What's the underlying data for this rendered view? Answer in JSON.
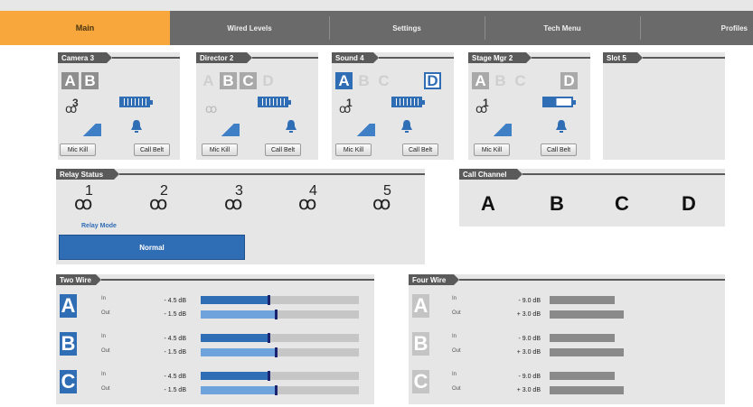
{
  "nav": {
    "tabs": [
      {
        "label": "Main",
        "active": true
      },
      {
        "label": "Wired Levels",
        "active": false
      },
      {
        "label": "Settings",
        "active": false
      },
      {
        "label": "Tech Menu",
        "active": false
      },
      {
        "label": "Profiles",
        "active": false
      }
    ]
  },
  "beltpacks": [
    {
      "name": "Camera 3",
      "channels": [
        "A",
        "B"
      ],
      "relay": "3",
      "battery_level": 1.0,
      "button1": "Mic Kill",
      "button2": "Call Belt"
    },
    {
      "name": "Director 2",
      "channels": [
        "A",
        "B",
        "C",
        "D"
      ],
      "relay": "",
      "battery_level": 1.0,
      "button1": "Mic Kill",
      "button2": "Call Belt"
    },
    {
      "name": "Sound 4",
      "channels": [
        "A",
        "B",
        "C",
        "D"
      ],
      "relay": "1",
      "battery_level": 1.0,
      "button1": "Mic Kill",
      "button2": "Call Belt"
    },
    {
      "name": "Stage Mgr 2",
      "channels": [
        "A",
        "B",
        "C",
        "D"
      ],
      "relay": "1",
      "battery_level": 0.45,
      "button1": "Mic Kill",
      "button2": "Call Belt"
    },
    {
      "name": "Slot 5"
    }
  ],
  "relay_status": {
    "title": "Relay Status",
    "relays": [
      "1",
      "2",
      "3",
      "4",
      "5"
    ],
    "mode_label": "Relay Mode",
    "mode_value": "Normal"
  },
  "call_channel": {
    "title": "Call Channel",
    "channels": [
      "A",
      "B",
      "C",
      "D"
    ]
  },
  "two_wire": {
    "title": "Two Wire",
    "in_label": "In",
    "out_label": "Out",
    "rows": [
      {
        "letter": "A",
        "in_db": "- 4.5 dB",
        "out_db": "- 1.5 dB",
        "in_level": 0.42,
        "out_level": 0.47
      },
      {
        "letter": "B",
        "in_db": "- 4.5 dB",
        "out_db": "- 1.5 dB",
        "in_level": 0.42,
        "out_level": 0.47
      },
      {
        "letter": "C",
        "in_db": "- 4.5 dB",
        "out_db": "- 1.5 dB",
        "in_level": 0.42,
        "out_level": 0.47
      }
    ]
  },
  "four_wire": {
    "title": "Four Wire",
    "in_label": "In",
    "out_label": "Out",
    "rows": [
      {
        "letter": "A",
        "in_db": "- 9.0 dB",
        "out_db": "+ 3.0 dB"
      },
      {
        "letter": "B",
        "in_db": "- 9.0 dB",
        "out_db": "+ 3.0 dB"
      },
      {
        "letter": "C",
        "in_db": "- 9.0 dB",
        "out_db": "+ 3.0 dB"
      }
    ]
  },
  "colors": {
    "accent": "#f7a73b",
    "blue": "#2f6db5",
    "nav": "#6a6a6a",
    "panel": "#e6e6e6"
  }
}
